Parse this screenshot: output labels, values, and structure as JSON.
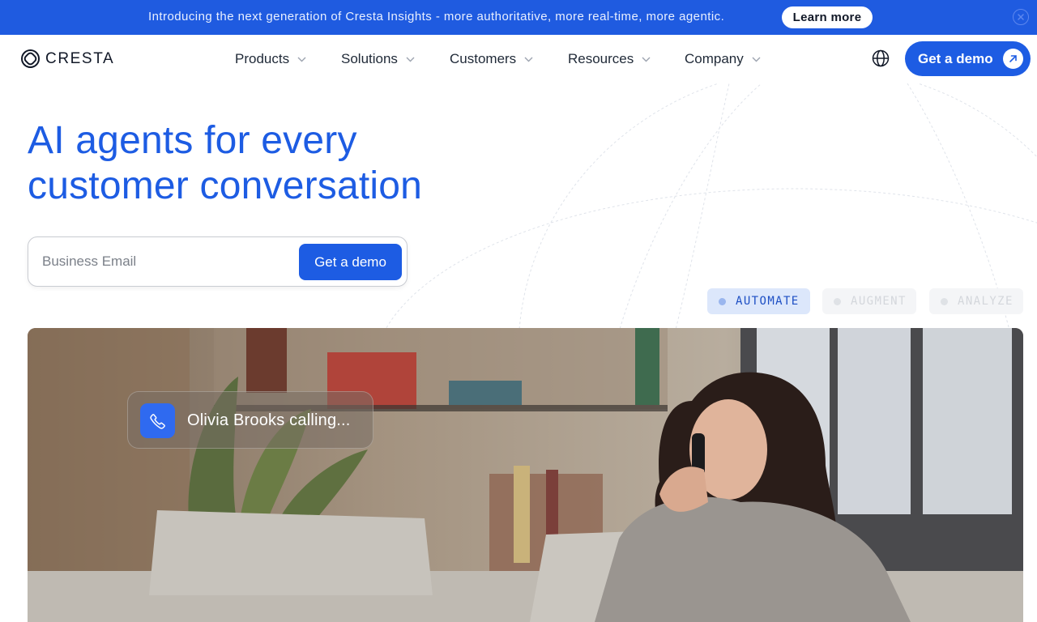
{
  "announcement": {
    "text": "Introducing the next generation of Cresta Insights - more authoritative, more real-time, more agentic.",
    "cta": "Learn more"
  },
  "nav": {
    "logo_text": "CRESTA",
    "items": [
      {
        "label": "Products"
      },
      {
        "label": "Solutions"
      },
      {
        "label": "Customers"
      },
      {
        "label": "Resources"
      },
      {
        "label": "Company"
      }
    ],
    "demo_button": "Get a demo"
  },
  "hero": {
    "headline_line1": "AI agents for every",
    "headline_line2": "customer conversation",
    "email_placeholder": "Business Email",
    "form_button": "Get a demo",
    "tabs": [
      {
        "label": "AUTOMATE",
        "active": true
      },
      {
        "label": "AUGMENT",
        "active": false
      },
      {
        "label": "ANALYZE",
        "active": false
      }
    ]
  },
  "video": {
    "call_text": "Olivia Brooks calling..."
  },
  "colors": {
    "brand_blue": "#1d5ce3",
    "announce_bg": "#1f5be0",
    "active_tab_bg": "#dce7fb"
  },
  "icons": [
    "cresta-logo-icon",
    "chevron-down-icon",
    "globe-icon",
    "arrow-up-right-icon",
    "close-icon",
    "phone-icon"
  ]
}
